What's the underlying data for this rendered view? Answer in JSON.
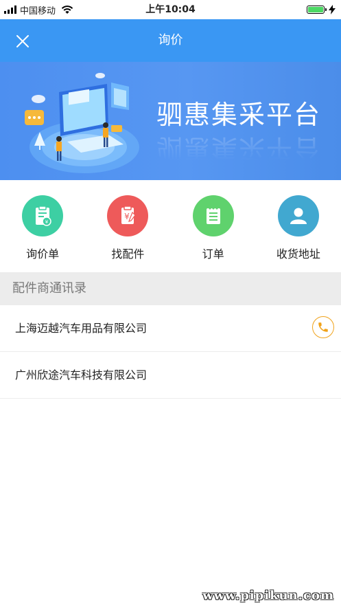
{
  "status_bar": {
    "carrier": "中国移动",
    "time": "上午10:04",
    "signal_icon": "cellular-signal-icon",
    "wifi_icon": "wifi-icon",
    "battery_icon": "battery-icon",
    "charging_icon": "charging-bolt-icon",
    "battery_level": 1.0
  },
  "nav": {
    "title": "询价",
    "close_icon": "close-icon",
    "background": "#3a97f3"
  },
  "banner": {
    "title": "驷惠集采平台"
  },
  "quick_menu": [
    {
      "label": "询价单",
      "icon": "inquiry-form-icon",
      "color": "#3dcfa3"
    },
    {
      "label": "找配件",
      "icon": "find-parts-icon",
      "color": "#ee5a5a"
    },
    {
      "label": "订单",
      "icon": "order-list-icon",
      "color": "#5fd26d"
    },
    {
      "label": "收货地址",
      "icon": "user-address-icon",
      "color": "#41a8d0"
    }
  ],
  "section": {
    "title": "配件商通讯录"
  },
  "suppliers": [
    {
      "name": "上海迈越汽车用品有限公司",
      "has_phone": true,
      "phone_icon": "phone-icon",
      "phone_color": "#f0a21a"
    },
    {
      "name": "广州欣途汽车科技有限公司",
      "has_phone": false
    }
  ],
  "watermark": "www.pipikun.com"
}
